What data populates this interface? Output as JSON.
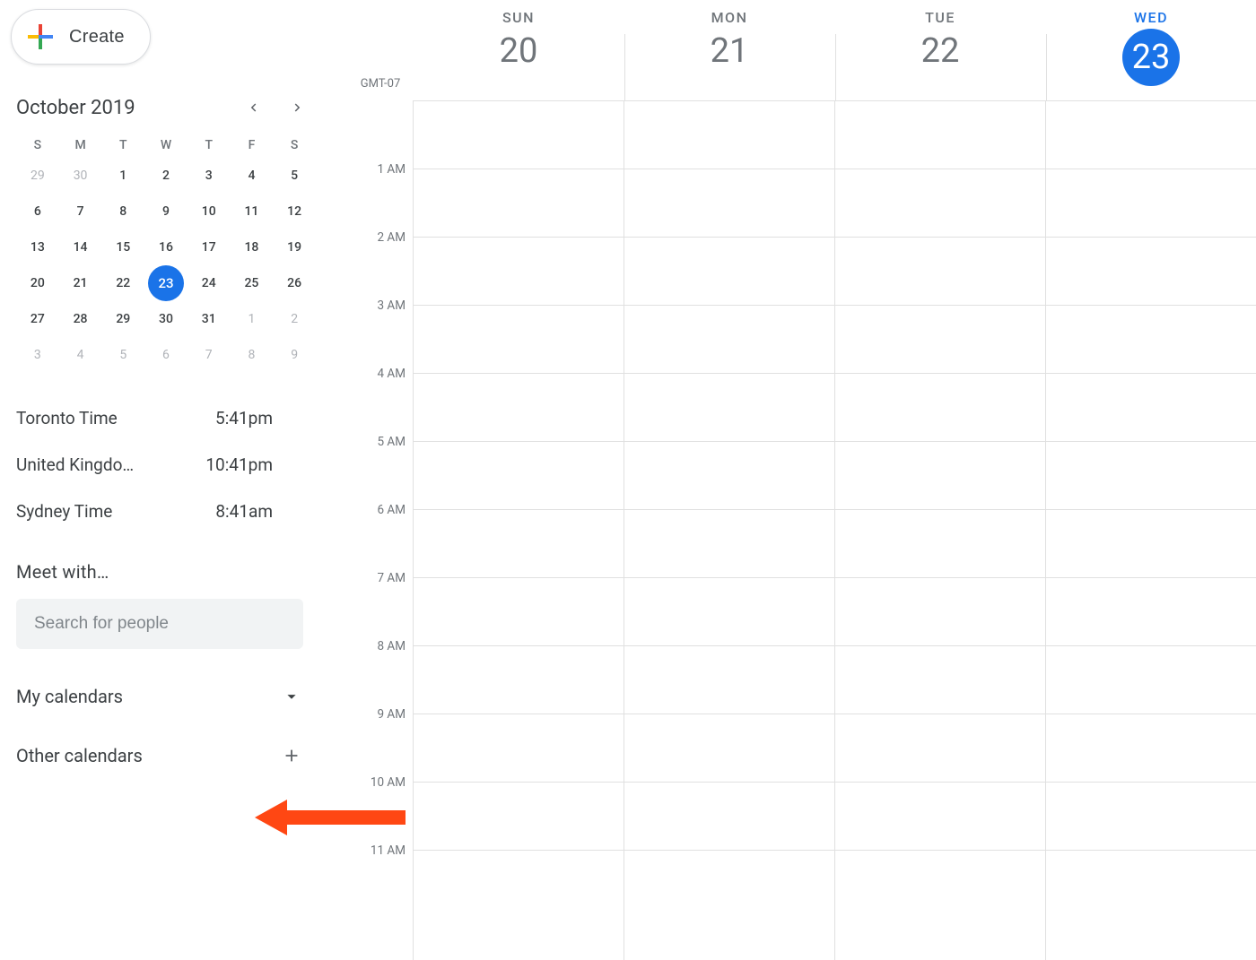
{
  "create": {
    "label": "Create"
  },
  "miniCal": {
    "monthLabel": "October 2019",
    "dow": [
      "S",
      "M",
      "T",
      "W",
      "T",
      "F",
      "S"
    ],
    "rows": [
      [
        {
          "n": "29",
          "o": true
        },
        {
          "n": "30",
          "o": true
        },
        {
          "n": "1"
        },
        {
          "n": "2"
        },
        {
          "n": "3"
        },
        {
          "n": "4"
        },
        {
          "n": "5"
        }
      ],
      [
        {
          "n": "6"
        },
        {
          "n": "7"
        },
        {
          "n": "8"
        },
        {
          "n": "9"
        },
        {
          "n": "10"
        },
        {
          "n": "11"
        },
        {
          "n": "12"
        }
      ],
      [
        {
          "n": "13"
        },
        {
          "n": "14"
        },
        {
          "n": "15"
        },
        {
          "n": "16"
        },
        {
          "n": "17"
        },
        {
          "n": "18"
        },
        {
          "n": "19"
        }
      ],
      [
        {
          "n": "20"
        },
        {
          "n": "21"
        },
        {
          "n": "22"
        },
        {
          "n": "23",
          "t": true
        },
        {
          "n": "24"
        },
        {
          "n": "25"
        },
        {
          "n": "26"
        }
      ],
      [
        {
          "n": "27"
        },
        {
          "n": "28"
        },
        {
          "n": "29"
        },
        {
          "n": "30"
        },
        {
          "n": "31"
        },
        {
          "n": "1",
          "o": true
        },
        {
          "n": "2",
          "o": true
        }
      ],
      [
        {
          "n": "3",
          "o": true
        },
        {
          "n": "4",
          "o": true
        },
        {
          "n": "5",
          "o": true
        },
        {
          "n": "6",
          "o": true
        },
        {
          "n": "7",
          "o": true
        },
        {
          "n": "8",
          "o": true
        },
        {
          "n": "9",
          "o": true
        }
      ]
    ]
  },
  "clocks": [
    {
      "loc": "Toronto Time",
      "time": "5:41pm",
      "icon": "sun"
    },
    {
      "loc": "United Kingdo…",
      "time": "10:41pm",
      "icon": "moon"
    },
    {
      "loc": "Sydney Time",
      "time": "8:41am",
      "icon": "sun"
    }
  ],
  "meet": {
    "heading": "Meet with…",
    "placeholder": "Search for people"
  },
  "calSections": {
    "my": "My calendars",
    "other": "Other calendars"
  },
  "timezone": "GMT-07",
  "dayHeaders": [
    {
      "dow": "SUN",
      "num": "20",
      "active": false
    },
    {
      "dow": "MON",
      "num": "21",
      "active": false
    },
    {
      "dow": "TUE",
      "num": "22",
      "active": false
    },
    {
      "dow": "WED",
      "num": "23",
      "active": true
    }
  ],
  "hours": [
    "",
    "1 AM",
    "2 AM",
    "3 AM",
    "4 AM",
    "5 AM",
    "6 AM",
    "7 AM",
    "8 AM",
    "9 AM",
    "10 AM",
    "11 AM"
  ],
  "annotation": {
    "color": "#ff4713"
  }
}
